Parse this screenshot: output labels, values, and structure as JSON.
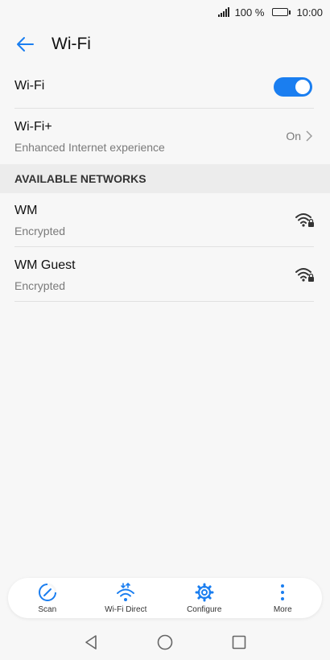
{
  "status": {
    "battery_text": "100 %",
    "time": "10:00"
  },
  "header": {
    "title": "Wi-Fi"
  },
  "wifi_row": {
    "label": "Wi-Fi",
    "enabled": true
  },
  "wifi_plus": {
    "label": "Wi-Fi+",
    "subtitle": "Enhanced Internet experience",
    "value": "On"
  },
  "section": {
    "title": "AVAILABLE NETWORKS"
  },
  "networks": [
    {
      "name": "WM",
      "security": "Encrypted"
    },
    {
      "name": "WM Guest",
      "security": "Encrypted"
    }
  ],
  "bottom_actions": [
    {
      "label": "Scan",
      "icon": "scan-icon"
    },
    {
      "label": "Wi-Fi Direct",
      "icon": "wifi-direct-icon"
    },
    {
      "label": "Configure",
      "icon": "gear-icon"
    },
    {
      "label": "More",
      "icon": "more-vertical-icon"
    }
  ],
  "colors": {
    "accent": "#1a7ef0",
    "background": "#f7f7f7",
    "section_bg": "#ececec"
  }
}
